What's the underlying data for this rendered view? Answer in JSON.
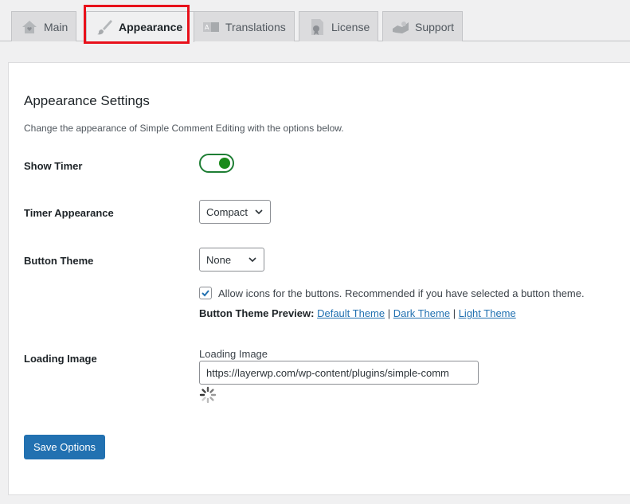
{
  "tabs": [
    {
      "label": "Main",
      "icon": "home-icon"
    },
    {
      "label": "Appearance",
      "icon": "paintbrush-icon",
      "active": true
    },
    {
      "label": "Translations",
      "icon": "translation-icon"
    },
    {
      "label": "License",
      "icon": "license-badge-icon"
    },
    {
      "label": "Support",
      "icon": "support-icon"
    }
  ],
  "page": {
    "title": "Appearance Settings",
    "description": "Change the appearance of Simple Comment Editing with the options below."
  },
  "settings": {
    "show_timer": {
      "label": "Show Timer",
      "enabled": true
    },
    "timer_appearance": {
      "label": "Timer Appearance",
      "value": "Compact"
    },
    "button_theme": {
      "label": "Button Theme",
      "value": "None",
      "allow_icons_checked": true,
      "allow_icons_text": "Allow icons for the buttons. Recommended if you have selected a button theme.",
      "preview_label": "Button Theme Preview:",
      "preview_links": [
        "Default Theme",
        "Dark Theme",
        "Light Theme"
      ],
      "separator": "|"
    },
    "loading_image": {
      "label": "Loading Image",
      "field_label": "Loading Image",
      "value": "https://layerwp.com/wp-content/plugins/simple-comm"
    }
  },
  "actions": {
    "save_label": "Save Options"
  },
  "colors": {
    "accent": "#2271b1",
    "toggle_on": "#1a8a1a",
    "highlight": "#e8101a"
  }
}
